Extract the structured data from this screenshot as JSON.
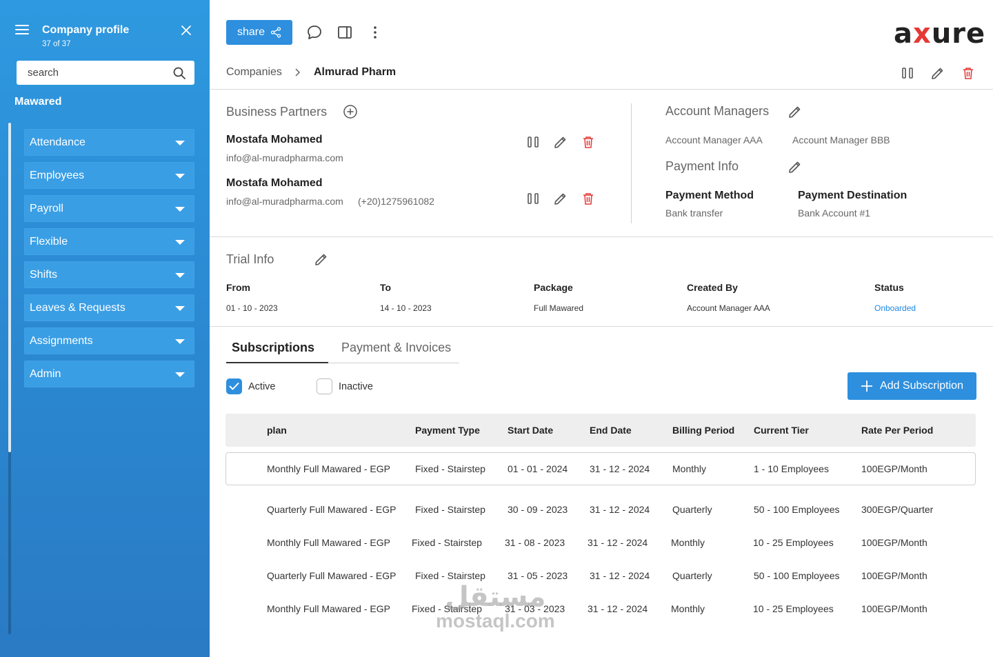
{
  "sidebar": {
    "title": "Company profile",
    "count": "37 of 37",
    "search_placeholder": "search",
    "group": "Mawared",
    "items": [
      {
        "label": "Attendance"
      },
      {
        "label": "Employees"
      },
      {
        "label": "Payroll"
      },
      {
        "label": "Flexible"
      },
      {
        "label": "Shifts"
      },
      {
        "label": "Leaves & Requests"
      },
      {
        "label": "Assignments"
      },
      {
        "label": "Admin"
      }
    ]
  },
  "toolbar": {
    "share_label": "share",
    "logo_parts": [
      "a",
      "x",
      "ure"
    ]
  },
  "breadcrumb": {
    "parent": "Companies",
    "current": "Almurad Pharm"
  },
  "business_partners": {
    "title": "Business Partners",
    "partners": [
      {
        "name": "Mostafa Mohamed",
        "email": "info@al-muradpharma.com",
        "phone": ""
      },
      {
        "name": "Mostafa Mohamed",
        "email": "info@al-muradpharma.com",
        "phone": "(+20)1275961082"
      }
    ]
  },
  "account_managers": {
    "title": "Account Managers",
    "managers": [
      "Account Manager AAA",
      "Account Manager BBB"
    ]
  },
  "payment_info": {
    "title": "Payment Info",
    "method_label": "Payment Method",
    "method_value": "Bank transfer",
    "destination_label": "Payment Destination",
    "destination_value": "Bank Account #1"
  },
  "trial_info": {
    "title": "Trial Info",
    "fields": [
      {
        "label": "From",
        "value": "01 - 10 - 2023"
      },
      {
        "label": "To",
        "value": "14 - 10 - 2023"
      },
      {
        "label": "Package",
        "value": "Full Mawared"
      },
      {
        "label": "Created By",
        "value": "Account Manager AAA"
      },
      {
        "label": "Status",
        "value": "Onboarded"
      }
    ]
  },
  "tabs": [
    {
      "label": "Subscriptions",
      "active": true
    },
    {
      "label": "Payment & Invoices",
      "active": false
    }
  ],
  "filters": {
    "active_label": "Active",
    "active_checked": true,
    "inactive_label": "Inactive",
    "inactive_checked": false
  },
  "add_subscription_label": "Add Subscription",
  "table": {
    "columns": [
      "plan",
      "Payment Type",
      "Start Date",
      "End Date",
      "Billing Period",
      "Current Tier",
      "Rate Per Period"
    ],
    "rows": [
      [
        "Monthly Full Mawared - EGP",
        "Fixed - Stairstep",
        "01 - 01 - 2024",
        "31 - 12 - 2024",
        "Monthly",
        "1 - 10 Employees",
        "100EGP/Month"
      ],
      [
        "Quarterly Full Mawared - EGP",
        "Fixed - Stairstep",
        "30 - 09 - 2023",
        "31 - 12 - 2024",
        "Quarterly",
        "50 - 100 Employees",
        "300EGP/Quarter"
      ],
      [
        "Monthly Full Mawared - EGP",
        "Fixed - Stairstep",
        "31 - 08 - 2023",
        "31 - 12 - 2024",
        "Monthly",
        "10 - 25 Employees",
        "100EGP/Month"
      ],
      [
        "Quarterly Full Mawared - EGP",
        "Fixed - Stairstep",
        "31 - 05 - 2023",
        "31 - 12 - 2024",
        "Quarterly",
        "50 - 100 Employees",
        "100EGP/Month"
      ],
      [
        "Monthly Full Mawared - EGP",
        "Fixed - Stairstep",
        "31 - 03 - 2023",
        "31 - 12 - 2024",
        "Monthly",
        "10 - 25 Employees",
        "100EGP/Month"
      ]
    ]
  },
  "watermark": {
    "arabic": "مستقل",
    "latin": "mostaql.com"
  },
  "colors": {
    "primary": "#2d8fde",
    "danger": "#e53935",
    "link": "#1e88e5",
    "sidebar": "#2e99e0"
  }
}
